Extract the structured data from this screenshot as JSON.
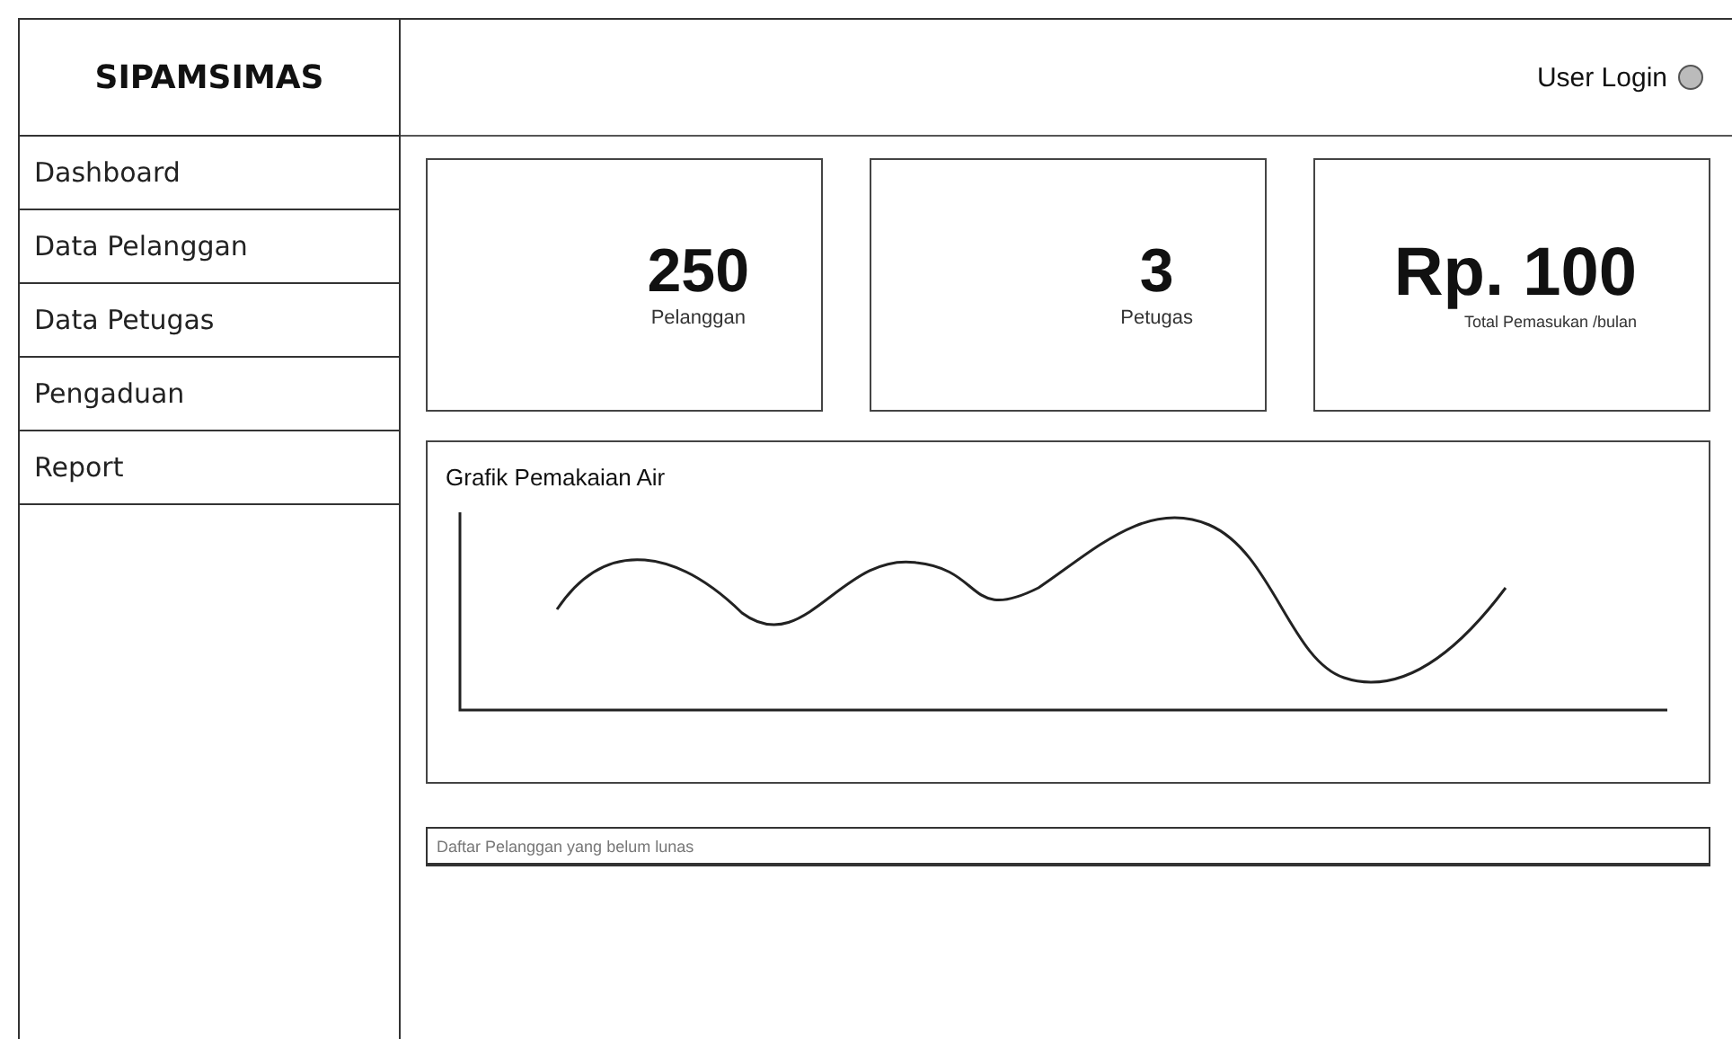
{
  "app_title": "SIPAMSIMAS",
  "header": {
    "user_label": "User Login"
  },
  "sidebar": {
    "items": [
      {
        "label": "Dashboard"
      },
      {
        "label": "Data Pelanggan"
      },
      {
        "label": "Data Petugas"
      },
      {
        "label": "Pengaduan"
      },
      {
        "label": "Report"
      }
    ]
  },
  "stats": [
    {
      "value": "250",
      "label": "Pelanggan",
      "kind": "normal"
    },
    {
      "value": "3",
      "label": "Petugas",
      "kind": "normal"
    },
    {
      "value": "Rp. 100",
      "label": "Total Pemasukan /bulan",
      "kind": "large"
    }
  ],
  "chart_panel": {
    "title": "Grafik Pemakaian Air"
  },
  "table_header": {
    "title": "Daftar Pelanggan yang belum lunas"
  }
}
